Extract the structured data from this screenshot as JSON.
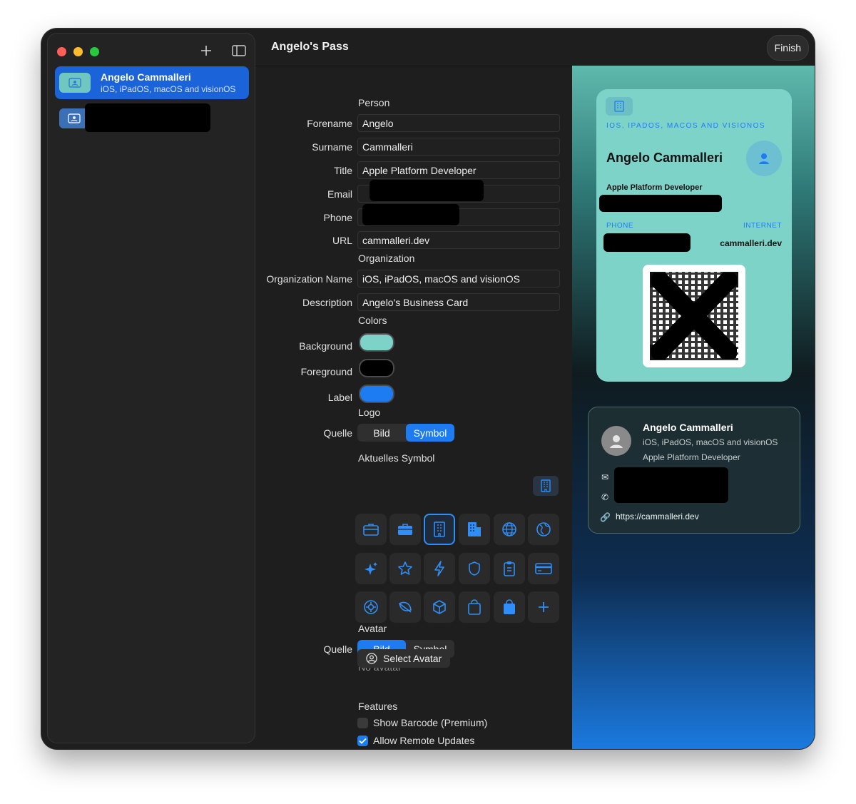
{
  "window": {
    "title": "Angelo's Pass",
    "finish_label": "Finish"
  },
  "sidebar": {
    "items": [
      {
        "title": "Angelo Cammalleri",
        "subtitle": "iOS, iPadOS, macOS and visionOS"
      }
    ]
  },
  "form": {
    "sections": {
      "person": "Person",
      "organization": "Organization",
      "colors": "Colors",
      "logo": "Logo",
      "avatar": "Avatar",
      "features": "Features"
    },
    "labels": {
      "forename": "Forename",
      "surname": "Surname",
      "title": "Title",
      "email": "Email",
      "phone": "Phone",
      "url": "URL",
      "org_name": "Organization Name",
      "description": "Description",
      "background": "Background",
      "foreground": "Foreground",
      "label": "Label",
      "logo_source": "Quelle",
      "avatar_source": "Quelle",
      "current_symbol": "Aktuelles Symbol"
    },
    "values": {
      "forename": "Angelo",
      "surname": "Cammalleri",
      "title": "Apple Platform Developer",
      "url": "cammalleri.dev",
      "org_name": "iOS, iPadOS, macOS and visionOS",
      "description": "Angelo's Business Card"
    },
    "colors": {
      "background": "#7ed3c8",
      "foreground": "#000000",
      "label": "#1e7cf2"
    },
    "logo_source": {
      "options": [
        "Bild",
        "Symbol"
      ],
      "selected": "Symbol"
    },
    "avatar_source": {
      "options": [
        "Bild",
        "Symbol"
      ],
      "selected": "Bild"
    },
    "no_avatar": "No avatar",
    "select_avatar": "Select Avatar",
    "features": [
      {
        "label": "Show Barcode (Premium)",
        "checked": false
      },
      {
        "label": "Allow Remote Updates",
        "checked": true
      }
    ],
    "symbols": [
      "briefcase-icon",
      "briefcase-fill-icon",
      "building-icon",
      "building-fill-icon",
      "globe-icon",
      "globe-americas-icon",
      "sparkles-icon",
      "star-icon",
      "bolt-icon",
      "shield-icon",
      "clipboard-icon",
      "creditcard-icon",
      "gear-badge-icon",
      "leaf-icon",
      "cube-icon",
      "bag-icon",
      "bag-fill-icon",
      "plus-icon"
    ],
    "selected_symbol": "building-icon"
  },
  "preview": {
    "card": {
      "org": "IOS, IPADOS, MACOS AND VISIONOS",
      "name": "Angelo Cammalleri",
      "title": "Apple Platform Developer",
      "phone_label": "PHONE",
      "internet_label": "INTERNET",
      "url": "cammalleri.dev"
    },
    "contact": {
      "name": "Angelo Cammalleri",
      "org": "iOS, iPadOS, macOS and visionOS",
      "title": "Apple Platform Developer",
      "url": "https://cammalleri.dev"
    }
  }
}
